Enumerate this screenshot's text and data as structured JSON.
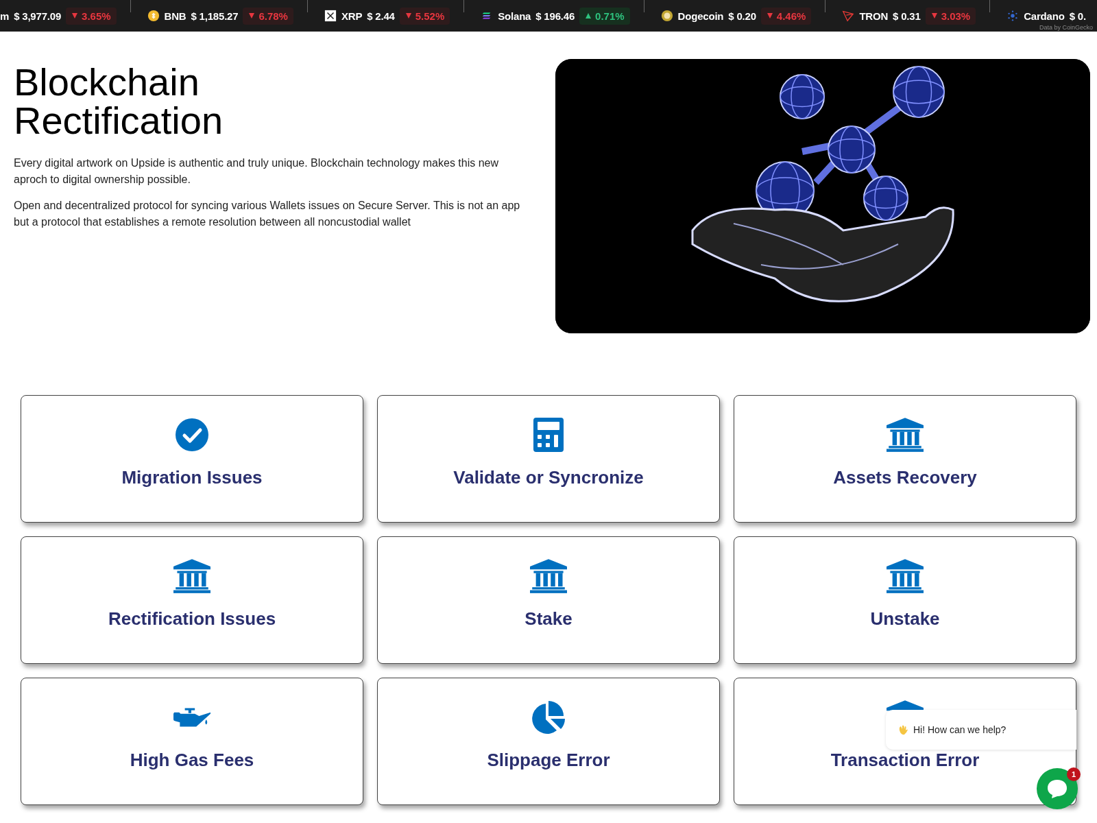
{
  "ticker": [
    {
      "name": "m",
      "price": "$ 3,977.09",
      "change": "3.65%",
      "up": false
    },
    {
      "kind": "bnb",
      "name": "BNB",
      "price": "$ 1,185.27",
      "change": "6.78%",
      "up": false
    },
    {
      "kind": "xrp",
      "name": "XRP",
      "price": "$ 2.44",
      "change": "5.52%",
      "up": false
    },
    {
      "kind": "sol",
      "name": "Solana",
      "price": "$ 196.46",
      "change": "0.71%",
      "up": true
    },
    {
      "kind": "doge",
      "name": "Dogecoin",
      "price": "$ 0.20",
      "change": "4.46%",
      "up": false
    },
    {
      "kind": "tron",
      "name": "TRON",
      "price": "$ 0.31",
      "change": "3.03%",
      "up": false
    },
    {
      "kind": "ada",
      "name": "Cardano",
      "price": "$ 0."
    }
  ],
  "ticker_credit": "Data by CoinGecko",
  "hero": {
    "title_lines": [
      "Blockchain",
      "Rectification"
    ],
    "paragraphs": [
      "Every digital artwork on Upside is authentic and truly unique. Blockchain technology makes this new aproch to digital ownership possible.",
      "Open and decentralized protocol for syncing various Wallets issues on Secure Server. This is not an app but a protocol that establishes a remote resolution between all noncustodial wallet"
    ]
  },
  "cards": [
    {
      "kind": "check",
      "title": "Migration Issues"
    },
    {
      "kind": "calculator",
      "title": "Validate or Syncronize"
    },
    {
      "kind": "bank",
      "title": "Assets Recovery"
    },
    {
      "kind": "bank",
      "title": "Rectification Issues"
    },
    {
      "kind": "bank",
      "title": "Stake"
    },
    {
      "kind": "bank",
      "title": "Unstake"
    },
    {
      "kind": "oil",
      "title": "High Gas Fees"
    },
    {
      "kind": "pie",
      "title": "Slippage Error"
    },
    {
      "kind": "bank",
      "title": "Transaction Error"
    }
  ],
  "chat": {
    "greeting": "Hi! How can we help?",
    "badge": "1"
  }
}
